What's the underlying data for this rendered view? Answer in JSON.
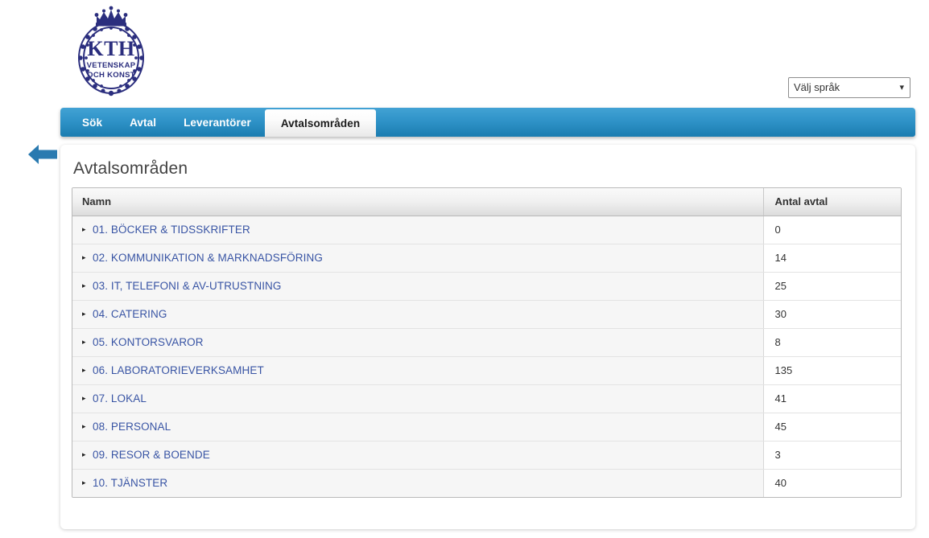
{
  "header": {
    "logo_name": "kth-logo",
    "logo_text": "KTH",
    "logo_motto_line1": "VETENSKAP",
    "logo_motto_line2": "OCH KONST",
    "language_select": {
      "value": "Välj språk",
      "chevron": "❯"
    }
  },
  "nav": {
    "tabs": [
      {
        "label": "Sök",
        "active": false
      },
      {
        "label": "Avtal",
        "active": false
      },
      {
        "label": "Leverantörer",
        "active": false
      },
      {
        "label": "Avtalsområden",
        "active": true
      }
    ]
  },
  "back_arrow": {
    "name": "back-arrow-icon"
  },
  "main": {
    "title": "Avtalsområden",
    "table": {
      "columns": [
        "Namn",
        "Antal avtal"
      ],
      "expander_glyph": "▸",
      "rows": [
        {
          "name": "01. BÖCKER & TIDSSKRIFTER",
          "count": "0"
        },
        {
          "name": "02. KOMMUNIKATION & MARKNADSFÖRING",
          "count": "14"
        },
        {
          "name": "03. IT, TELEFONI & AV-UTRUSTNING",
          "count": "25"
        },
        {
          "name": "04. CATERING",
          "count": "30"
        },
        {
          "name": "05. KONTORSVAROR",
          "count": "8"
        },
        {
          "name": "06. LABORATORIEVERKSAMHET",
          "count": "135"
        },
        {
          "name": "07. LOKAL",
          "count": "41"
        },
        {
          "name": "08. PERSONAL",
          "count": "45"
        },
        {
          "name": "09. RESOR & BOENDE",
          "count": "3"
        },
        {
          "name": "10. TJÄNSTER",
          "count": "40"
        }
      ]
    }
  },
  "colors": {
    "nav_blue_top": "#42a2d4",
    "nav_blue_bottom": "#1b7cb0",
    "link_blue": "#3854a4",
    "arrow_blue": "#2a7ab0",
    "logo_navy": "#2b2e7e"
  }
}
